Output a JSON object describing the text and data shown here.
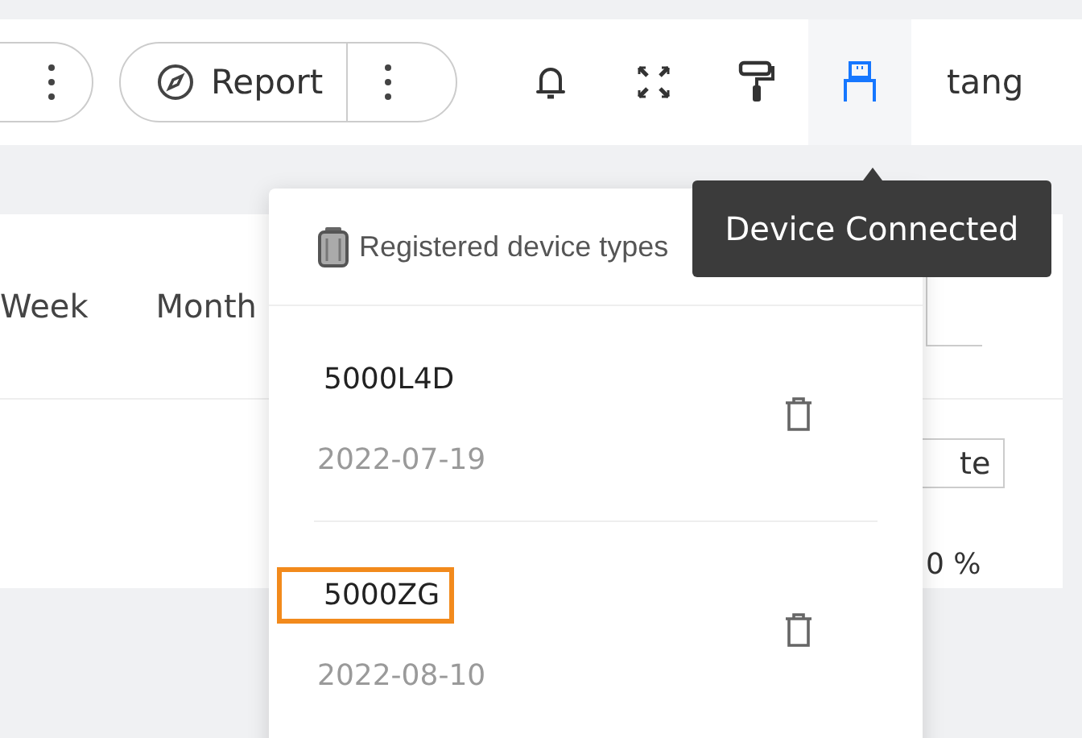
{
  "toolbar": {
    "report_button": "Report",
    "user": "tang",
    "device_icon_active": true
  },
  "tabs": [
    {
      "label": "Week",
      "selected": false
    },
    {
      "label": "Month",
      "selected": false
    }
  ],
  "panel": {
    "button": "te",
    "percent": "0 %"
  },
  "popover": {
    "title": "Registered device types",
    "devices": [
      {
        "name": "5000L4D",
        "date": "2022-07-19",
        "selected": false
      },
      {
        "name": "5000ZG",
        "date": "2022-08-10",
        "selected": true
      }
    ]
  },
  "tooltip": "Device Connected"
}
